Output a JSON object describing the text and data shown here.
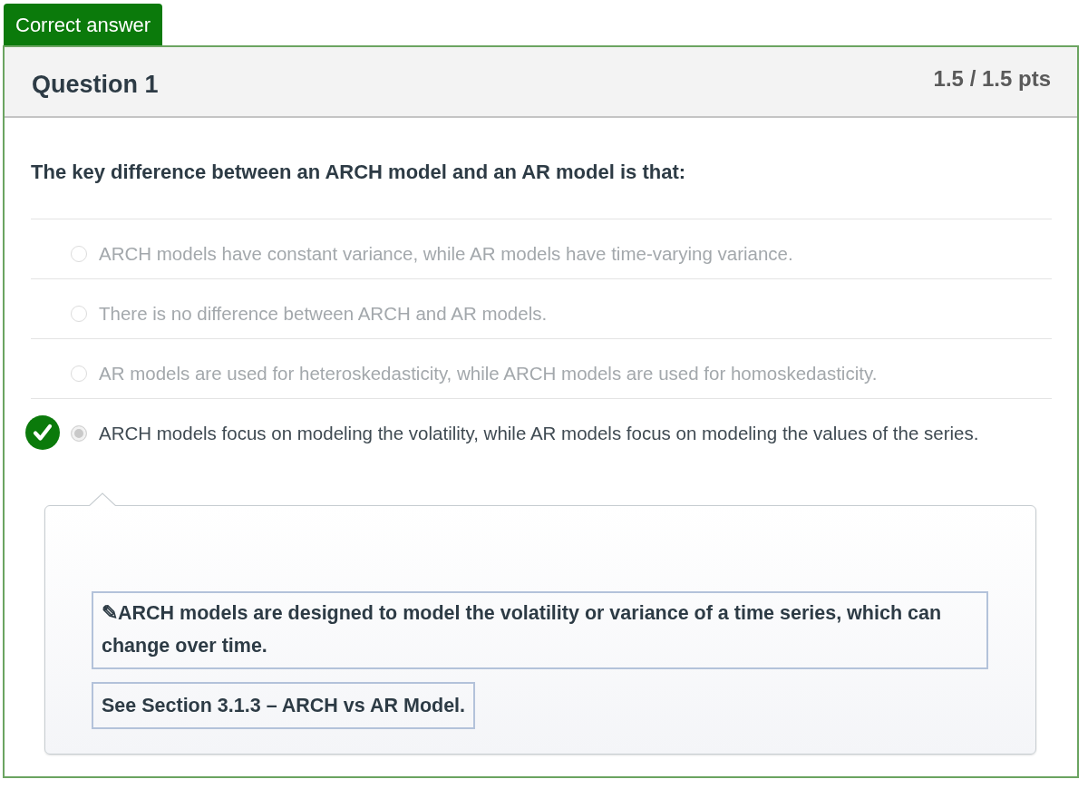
{
  "result_label": "Correct answer",
  "question": {
    "title": "Question 1",
    "score": "1.5 / 1.5 pts",
    "text": "The key difference between an ARCH model and an AR model is that:"
  },
  "answers": [
    {
      "text": "ARCH models have constant variance, while AR models have time-varying variance.",
      "selected": false,
      "correct": false
    },
    {
      "text": "There is no difference between ARCH and AR models.",
      "selected": false,
      "correct": false
    },
    {
      "text": "AR models are used for heteroskedasticity, while ARCH models are used for homoskedasticity.",
      "selected": false,
      "correct": false
    },
    {
      "text": "ARCH models focus on modeling the volatility, while AR models focus on modeling the values of the series.",
      "selected": true,
      "correct": true
    }
  ],
  "comment": {
    "paragraphs": [
      "✎ARCH models are designed to model the volatility or variance of a time series, which can change over time.",
      "See Section 3.1.3 – ARCH vs AR Model."
    ]
  }
}
